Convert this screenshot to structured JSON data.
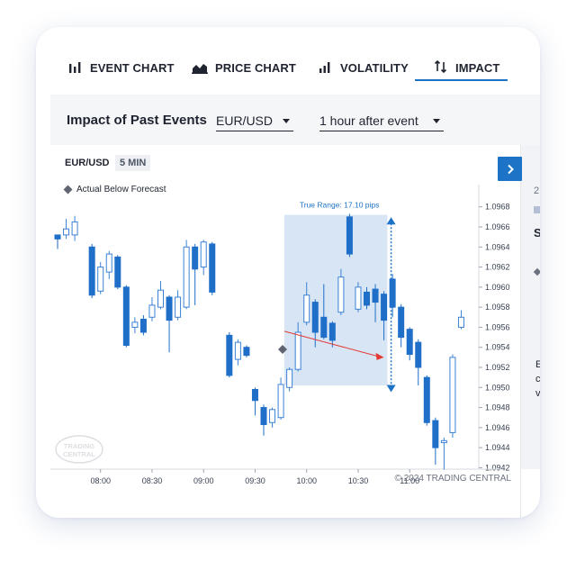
{
  "tabs": [
    {
      "label": "EVENT CHART",
      "icon": "bar-chart-icon"
    },
    {
      "label": "PRICE CHART",
      "icon": "area-chart-icon"
    },
    {
      "label": "VOLATILITY",
      "icon": "volatility-icon"
    },
    {
      "label": "IMPACT",
      "icon": "sort-arrows-icon",
      "active": true
    }
  ],
  "header": {
    "title": "Impact of Past Events",
    "pair_select": "EUR/USD",
    "window_select": "1 hour after event"
  },
  "chart": {
    "pair": "EUR/USD",
    "timeframe": "5 MIN",
    "legend": "Actual Below Forecast",
    "range_label": "True Range: 17.10 pips",
    "copyright": "© 2024 TRADING CENTRAL",
    "watermark": [
      "TRADING",
      "CENTRAL"
    ]
  },
  "right_panel": {
    "fragments": [
      "2",
      "S",
      "E",
      "c",
      "v"
    ]
  },
  "colors": {
    "accent": "#1d74c7",
    "candle_down": "#1f6fc9",
    "candle_up_stroke": "#3b82d6",
    "highlight": "#cddff2",
    "arrow": "#e53935"
  },
  "chart_data": {
    "type": "candlestick",
    "y_ticks": [
      "1.0968",
      "1.0966",
      "1.0964",
      "1.0962",
      "1.0960",
      "1.0958",
      "1.0956",
      "1.0954",
      "1.0952",
      "1.0950",
      "1.0948",
      "1.0946",
      "1.0944",
      "1.0942"
    ],
    "x_ticks": [
      "08:00",
      "08:30",
      "09:00",
      "09:30",
      "10:00",
      "10:30",
      "11:00"
    ],
    "ylim": [
      1.09415,
      1.09695
    ],
    "highlight": {
      "from": "09:47",
      "to": "10:47",
      "low": 1.09502,
      "high": 1.09672
    },
    "arrow": {
      "from": {
        "t": "09:47",
        "p": 1.09556
      },
      "to": {
        "t": "10:45",
        "p": 1.0953
      }
    },
    "range_marker": {
      "t": "10:45",
      "from": 1.09667,
      "to": 1.09498
    },
    "event_marker": {
      "t": "09:46",
      "p": 1.09538
    },
    "candles": [
      {
        "t": "07:35",
        "o": 1.09652,
        "c": 1.09648,
        "h": 1.09652,
        "l": 1.09638
      },
      {
        "t": "07:40",
        "o": 1.09652,
        "c": 1.09658,
        "h": 1.09668,
        "l": 1.09648
      },
      {
        "t": "07:45",
        "o": 1.09652,
        "c": 1.09665,
        "h": 1.09671,
        "l": 1.09646
      },
      {
        "t": "07:55",
        "o": 1.0964,
        "c": 1.09592,
        "h": 1.09643,
        "l": 1.09589
      },
      {
        "t": "08:00",
        "o": 1.09596,
        "c": 1.0962,
        "h": 1.09625,
        "l": 1.09593
      },
      {
        "t": "08:05",
        "o": 1.09615,
        "c": 1.09633,
        "h": 1.09636,
        "l": 1.09608
      },
      {
        "t": "08:10",
        "o": 1.0963,
        "c": 1.096,
        "h": 1.09632,
        "l": 1.09598
      },
      {
        "t": "08:15",
        "o": 1.096,
        "c": 1.09542,
        "h": 1.09602,
        "l": 1.0954
      },
      {
        "t": "08:20",
        "o": 1.0956,
        "c": 1.09565,
        "h": 1.0957,
        "l": 1.09554
      },
      {
        "t": "08:25",
        "o": 1.09568,
        "c": 1.09555,
        "h": 1.09572,
        "l": 1.09552
      },
      {
        "t": "08:30",
        "o": 1.0957,
        "c": 1.09582,
        "h": 1.0959,
        "l": 1.09566
      },
      {
        "t": "08:35",
        "o": 1.0958,
        "c": 1.09597,
        "h": 1.09606,
        "l": 1.09578
      },
      {
        "t": "08:40",
        "o": 1.0959,
        "c": 1.09567,
        "h": 1.09592,
        "l": 1.09535
      },
      {
        "t": "08:45",
        "o": 1.0957,
        "c": 1.0959,
        "h": 1.09597,
        "l": 1.09567
      },
      {
        "t": "08:50",
        "o": 1.0958,
        "c": 1.0964,
        "h": 1.09647,
        "l": 1.09578
      },
      {
        "t": "08:55",
        "o": 1.0964,
        "c": 1.09618,
        "h": 1.09643,
        "l": 1.09582
      },
      {
        "t": "09:00",
        "o": 1.0962,
        "c": 1.09645,
        "h": 1.09647,
        "l": 1.09612
      },
      {
        "t": "09:05",
        "o": 1.09643,
        "c": 1.09595,
        "h": 1.09645,
        "l": 1.09592
      },
      {
        "t": "09:15",
        "o": 1.09552,
        "c": 1.09512,
        "h": 1.09555,
        "l": 1.0951
      },
      {
        "t": "09:20",
        "o": 1.09528,
        "c": 1.09545,
        "h": 1.09548,
        "l": 1.09522
      },
      {
        "t": "09:25",
        "o": 1.0954,
        "c": 1.09532,
        "h": 1.09542,
        "l": 1.0953
      },
      {
        "t": "09:30",
        "o": 1.09498,
        "c": 1.09487,
        "h": 1.095,
        "l": 1.09472
      },
      {
        "t": "09:35",
        "o": 1.0948,
        "c": 1.09463,
        "h": 1.09483,
        "l": 1.09452
      },
      {
        "t": "09:40",
        "o": 1.09465,
        "c": 1.09478,
        "h": 1.0948,
        "l": 1.0946
      },
      {
        "t": "09:45",
        "o": 1.0947,
        "c": 1.09503,
        "h": 1.0951,
        "l": 1.09468
      },
      {
        "t": "09:50",
        "o": 1.095,
        "c": 1.09518,
        "h": 1.0952,
        "l": 1.09496
      },
      {
        "t": "09:55",
        "o": 1.09518,
        "c": 1.09555,
        "h": 1.09565,
        "l": 1.09516
      },
      {
        "t": "10:00",
        "o": 1.09565,
        "c": 1.09592,
        "h": 1.09605,
        "l": 1.09562
      },
      {
        "t": "10:05",
        "o": 1.09585,
        "c": 1.09555,
        "h": 1.09588,
        "l": 1.0954
      },
      {
        "t": "10:10",
        "o": 1.0957,
        "c": 1.0955,
        "h": 1.09603,
        "l": 1.09548
      },
      {
        "t": "10:15",
        "o": 1.09564,
        "c": 1.09547,
        "h": 1.09566,
        "l": 1.0954
      },
      {
        "t": "10:20",
        "o": 1.09575,
        "c": 1.0961,
        "h": 1.09618,
        "l": 1.09572
      },
      {
        "t": "10:25",
        "o": 1.0967,
        "c": 1.09633,
        "h": 1.09673,
        "l": 1.0963
      },
      {
        "t": "10:30",
        "o": 1.09578,
        "c": 1.096,
        "h": 1.09605,
        "l": 1.09575
      },
      {
        "t": "10:35",
        "o": 1.09595,
        "c": 1.09582,
        "h": 1.096,
        "l": 1.09578
      },
      {
        "t": "10:40",
        "o": 1.09598,
        "c": 1.09585,
        "h": 1.09603,
        "l": 1.09565
      },
      {
        "t": "10:45",
        "o": 1.09593,
        "c": 1.09567,
        "h": 1.09596,
        "l": 1.09547
      },
      {
        "t": "10:50",
        "o": 1.09608,
        "c": 1.0958,
        "h": 1.09613,
        "l": 1.0957
      },
      {
        "t": "10:55",
        "o": 1.0958,
        "c": 1.0955,
        "h": 1.09583,
        "l": 1.0954
      },
      {
        "t": "11:00",
        "o": 1.09558,
        "c": 1.09533,
        "h": 1.0956,
        "l": 1.09527
      },
      {
        "t": "11:05",
        "o": 1.09545,
        "c": 1.0952,
        "h": 1.09548,
        "l": 1.09502
      },
      {
        "t": "11:10",
        "o": 1.0951,
        "c": 1.09465,
        "h": 1.09512,
        "l": 1.09462
      },
      {
        "t": "11:15",
        "o": 1.09467,
        "c": 1.0944,
        "h": 1.0947,
        "l": 1.09423
      },
      {
        "t": "11:20",
        "o": 1.09445,
        "c": 1.09447,
        "h": 1.0945,
        "l": 1.09418
      },
      {
        "t": "11:25",
        "o": 1.09455,
        "c": 1.0953,
        "h": 1.09533,
        "l": 1.0945
      },
      {
        "t": "11:30",
        "o": 1.0956,
        "c": 1.0957,
        "h": 1.09577,
        "l": 1.09558
      }
    ]
  }
}
